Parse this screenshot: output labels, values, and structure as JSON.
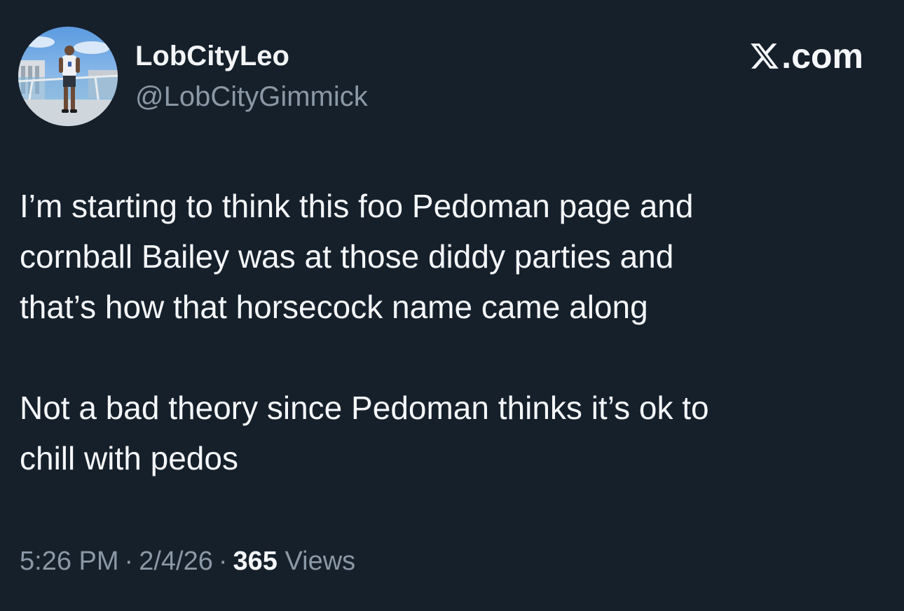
{
  "author": {
    "display_name": "LobCityLeo",
    "handle": "@LobCityGimmick",
    "avatar_icon": "profile-photo-icon"
  },
  "brand": {
    "logo_icon": "x-logo-icon",
    "domain": ".com"
  },
  "tweet": {
    "paragraphs": [
      "I’m starting to think this foo Pedoman page and\ncornball Bailey was at those diddy parties and\nthat’s how that horsecock name came along",
      "Not a bad theory since Pedoman thinks it’s ok to\nchill with pedos"
    ]
  },
  "meta": {
    "time": "5:26 PM",
    "separator": "·",
    "date": "2/4/26",
    "views_count": "365",
    "views_label": "Views"
  },
  "colors": {
    "background": "#16202b",
    "primary_text": "#f5f7f9",
    "secondary_text": "#8b98a5"
  }
}
